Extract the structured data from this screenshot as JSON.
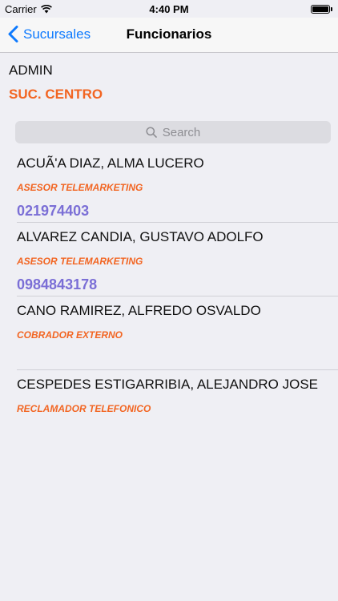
{
  "status_bar": {
    "carrier": "Carrier",
    "time": "4:40 PM",
    "battery_level": 1.0
  },
  "nav": {
    "back_label": "Sucursales",
    "title": "Funcionarios"
  },
  "header": {
    "user": "ADMIN",
    "branch": "SUC. CENTRO"
  },
  "search": {
    "placeholder": "Search"
  },
  "staff": [
    {
      "name": "ACUÃ'A DIAZ, ALMA LUCERO",
      "role": "ASESOR TELEMARKETING",
      "phone": "021974403"
    },
    {
      "name": "ALVAREZ CANDIA, GUSTAVO ADOLFO",
      "role": "ASESOR TELEMARKETING",
      "phone": "0984843178"
    },
    {
      "name": "CANO RAMIREZ, ALFREDO OSVALDO",
      "role": "COBRADOR EXTERNO",
      "phone": ""
    },
    {
      "name": "CESPEDES ESTIGARRIBIA, ALEJANDRO JOSE",
      "role": "RECLAMADOR TELEFONICO",
      "phone": ""
    }
  ],
  "colors": {
    "accent": "#0e7afe",
    "role": "#f26522",
    "phone": "#7b6fd6",
    "background": "#efeff4"
  }
}
